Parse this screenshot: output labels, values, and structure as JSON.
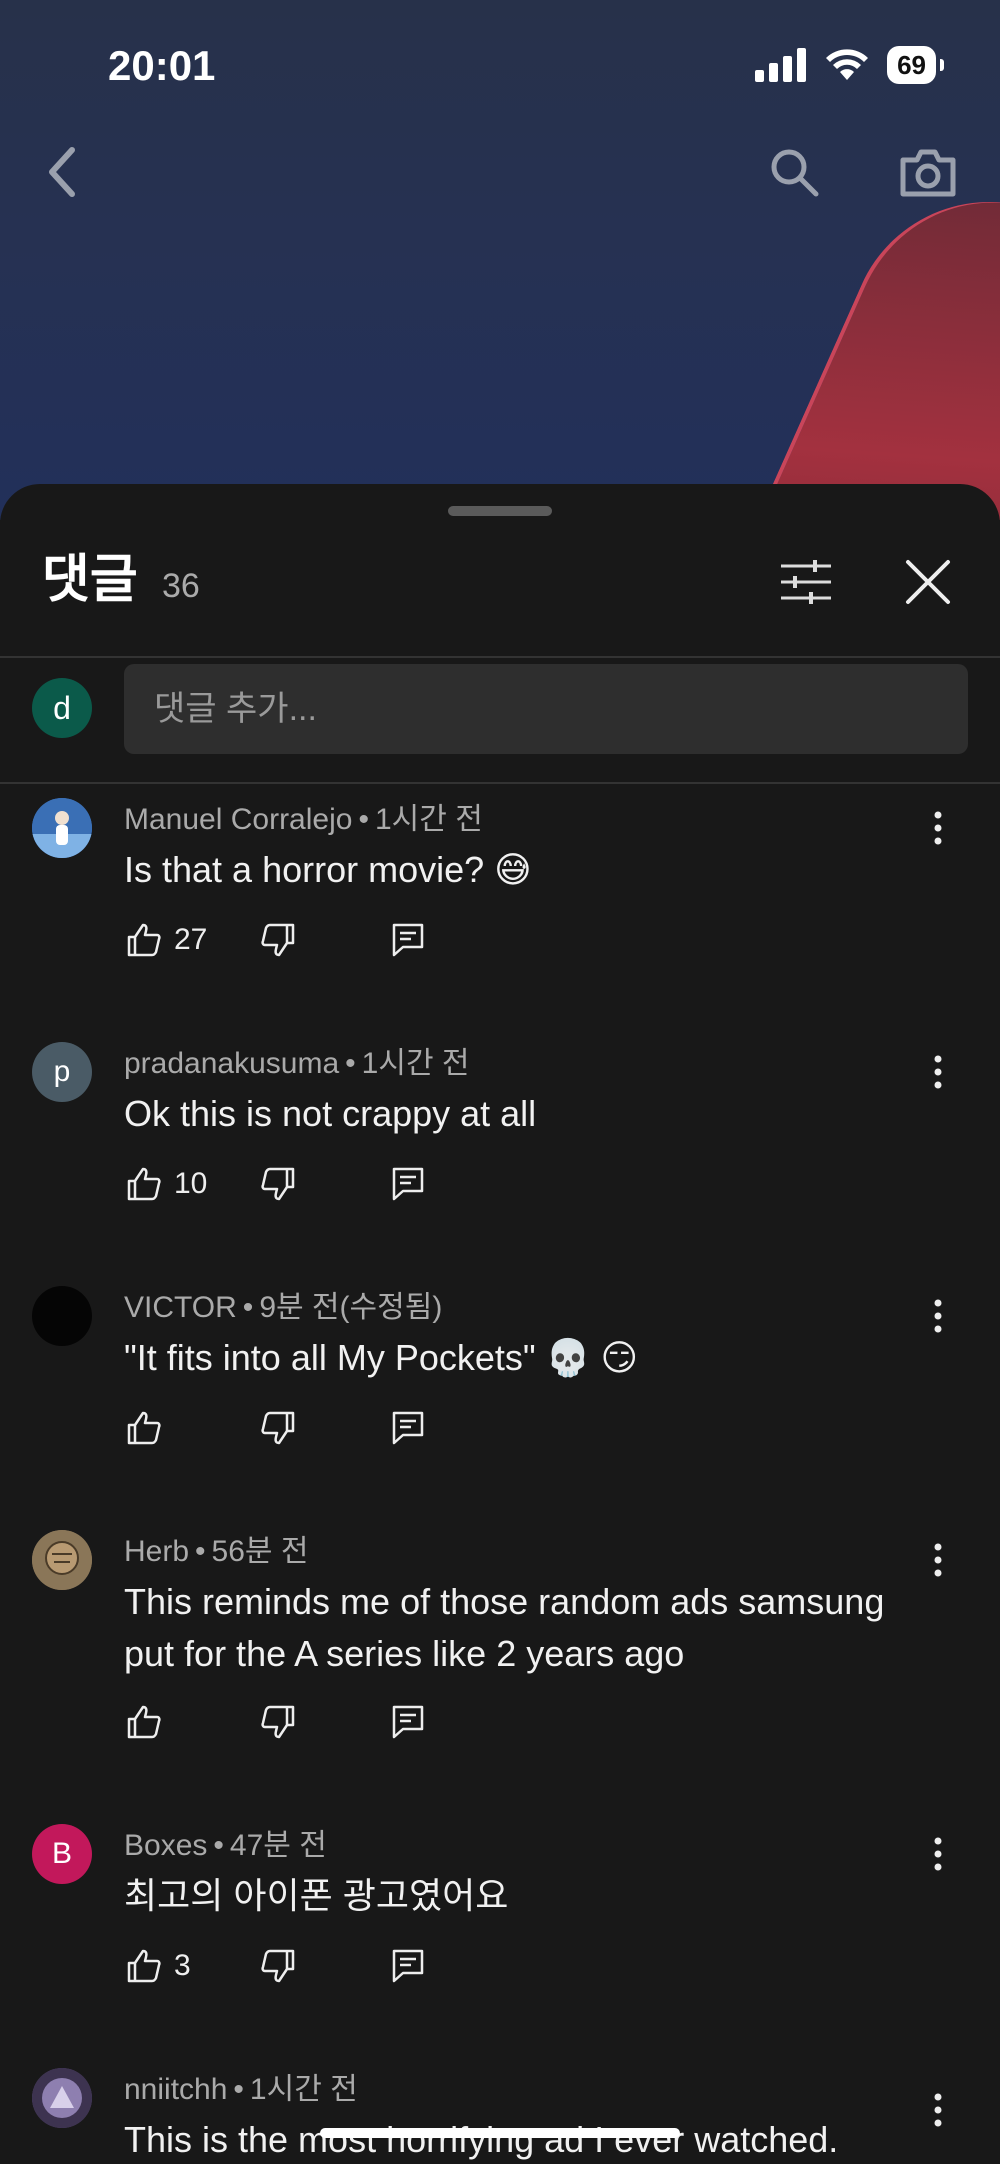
{
  "status_bar": {
    "time": "20:01",
    "battery": "69"
  },
  "sheet": {
    "title": "댓글",
    "count": "36",
    "add_comment_placeholder": "댓글 추가...",
    "my_avatar_letter": "d"
  },
  "comments": [
    {
      "author": "Manuel Corralejo",
      "time": "1시간 전",
      "text": "Is that a horror movie? 😅",
      "likes": "27",
      "avatar_letter": "",
      "avatar_color": "#3a6fb5"
    },
    {
      "author": "pradanakusuma",
      "time": "1시간 전",
      "text": "Ok this is not crappy at all",
      "likes": "10",
      "avatar_letter": "p",
      "avatar_color": "#4a5b66"
    },
    {
      "author": "VICTOR",
      "time": "9분 전(수정됨)",
      "text": "\"It fits into all My Pockets\" 💀 😏",
      "likes": "",
      "avatar_letter": "",
      "avatar_color": "#050505"
    },
    {
      "author": "Herb",
      "time": "56분 전",
      "text": "This reminds me of those random ads samsung put for the A series like 2 years ago",
      "likes": "",
      "avatar_letter": "",
      "avatar_color": "#7a6a4f"
    },
    {
      "author": "Boxes",
      "time": "47분 전",
      "text": "최고의 아이폰 광고였어요",
      "likes": "3",
      "avatar_letter": "B",
      "avatar_color": "#c2185b"
    },
    {
      "author": "nniitchh",
      "time": "1시간 전",
      "text": "This is the most horrifying ad I ever watched.",
      "likes": "",
      "avatar_letter": "",
      "avatar_color": "#5b4a7a"
    }
  ]
}
